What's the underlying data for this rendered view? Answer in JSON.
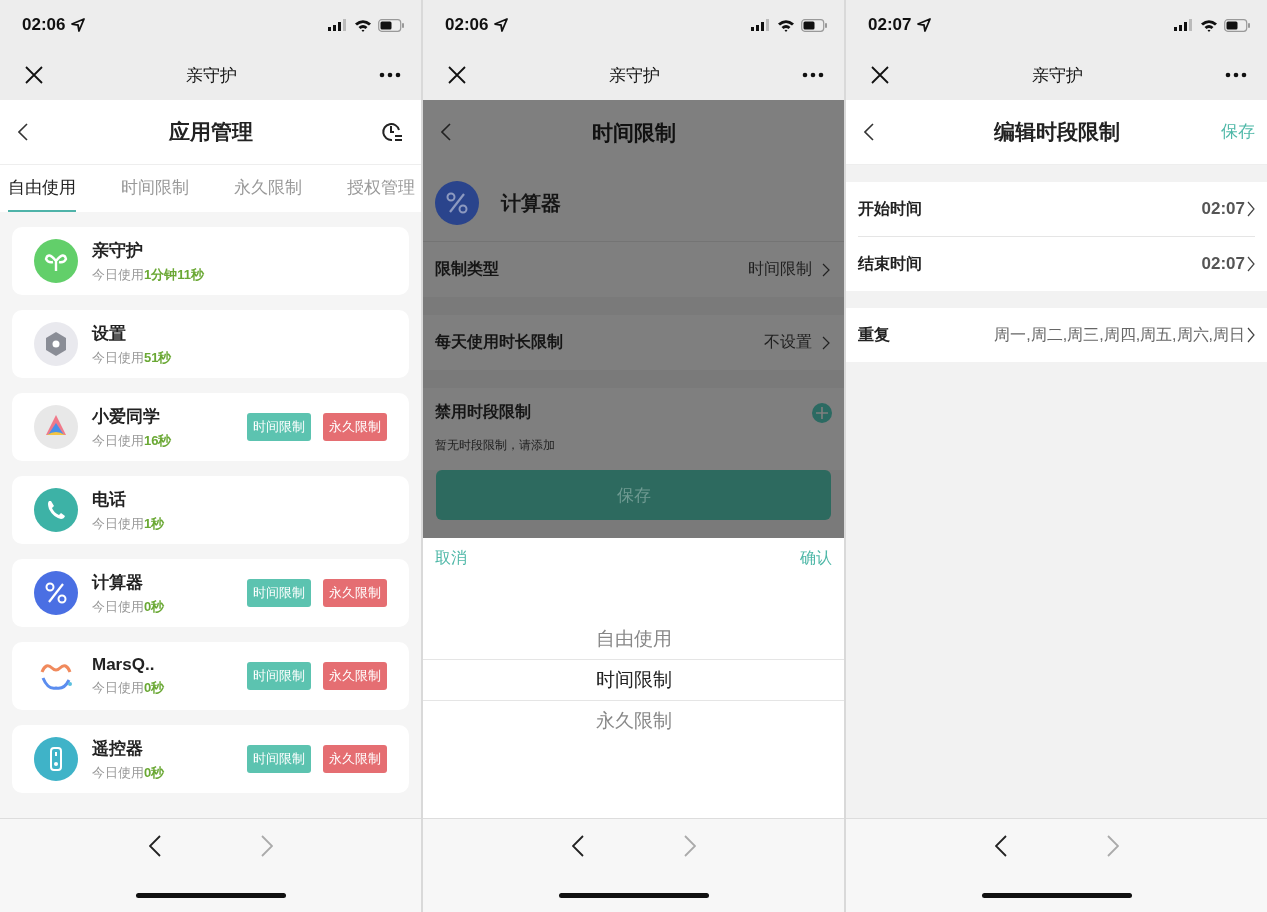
{
  "app_list_screen": {
    "status_bar": {
      "time": "02:06"
    },
    "mini_program_bar": {
      "title": "亲守护"
    },
    "header": {
      "title": "应用管理"
    },
    "tabs": [
      {
        "label": "自由使用",
        "selected": true
      },
      {
        "label": "时间限制",
        "selected": false
      },
      {
        "label": "永久限制",
        "selected": false
      },
      {
        "label": "授权管理",
        "selected": false
      }
    ],
    "apps": [
      {
        "name": "亲守护",
        "usage_label": "今日使用",
        "usage_value": "1分钟11秒"
      },
      {
        "name": "设置",
        "usage_label": "今日使用",
        "usage_value": "51秒"
      },
      {
        "name": "小爱同学",
        "usage_label": "今日使用",
        "usage_value": "16秒",
        "tags": [
          {
            "kind": "time",
            "label": "时间限制"
          },
          {
            "kind": "permanent",
            "label": "永久限制"
          }
        ]
      },
      {
        "name": "电话",
        "usage_label": "今日使用",
        "usage_value": "1秒"
      },
      {
        "name": "计算器",
        "usage_label": "今日使用",
        "usage_value": "0秒",
        "tags": [
          {
            "kind": "time",
            "label": "时间限制"
          },
          {
            "kind": "permanent",
            "label": "永久限制"
          }
        ]
      },
      {
        "name": "MarsQ..",
        "usage_label": "今日使用",
        "usage_value": "0秒",
        "tags": [
          {
            "kind": "time",
            "label": "时间限制"
          },
          {
            "kind": "permanent",
            "label": "永久限制"
          }
        ]
      },
      {
        "name": "遥控器",
        "usage_label": "今日使用",
        "usage_value": "0秒",
        "tags": [
          {
            "kind": "time",
            "label": "时间限制"
          },
          {
            "kind": "permanent",
            "label": "永久限制"
          }
        ]
      }
    ]
  },
  "time_limit_screen": {
    "status_bar": {
      "time": "02:06"
    },
    "mini_program_bar": {
      "title": "亲守护"
    },
    "header": {
      "title": "时间限制"
    },
    "app": {
      "name": "计算器"
    },
    "settings": [
      {
        "label": "限制类型",
        "value": "时间限制"
      },
      {
        "label": "每天使用时长限制",
        "value": "不设置"
      }
    ],
    "blocked_periods": {
      "title": "禁用时段限制",
      "hint": "暂无时段限制，请添加"
    },
    "save_button": "保存",
    "picker": {
      "cancel": "取消",
      "confirm": "确认",
      "options": [
        {
          "label": "自由使用",
          "selected": false
        },
        {
          "label": "时间限制",
          "selected": true
        },
        {
          "label": "永久限制",
          "selected": false
        }
      ]
    }
  },
  "edit_period_screen": {
    "status_bar": {
      "time": "02:07"
    },
    "mini_program_bar": {
      "title": "亲守护"
    },
    "header": {
      "title": "编辑时段限制",
      "action": "保存"
    },
    "time_rows": [
      {
        "label": "开始时间",
        "value": "02:07"
      },
      {
        "label": "结束时间",
        "value": "02:07"
      }
    ],
    "repeat_row": {
      "label": "重复",
      "value": "周一,周二,周三,周四,周五,周六,周日"
    }
  }
}
